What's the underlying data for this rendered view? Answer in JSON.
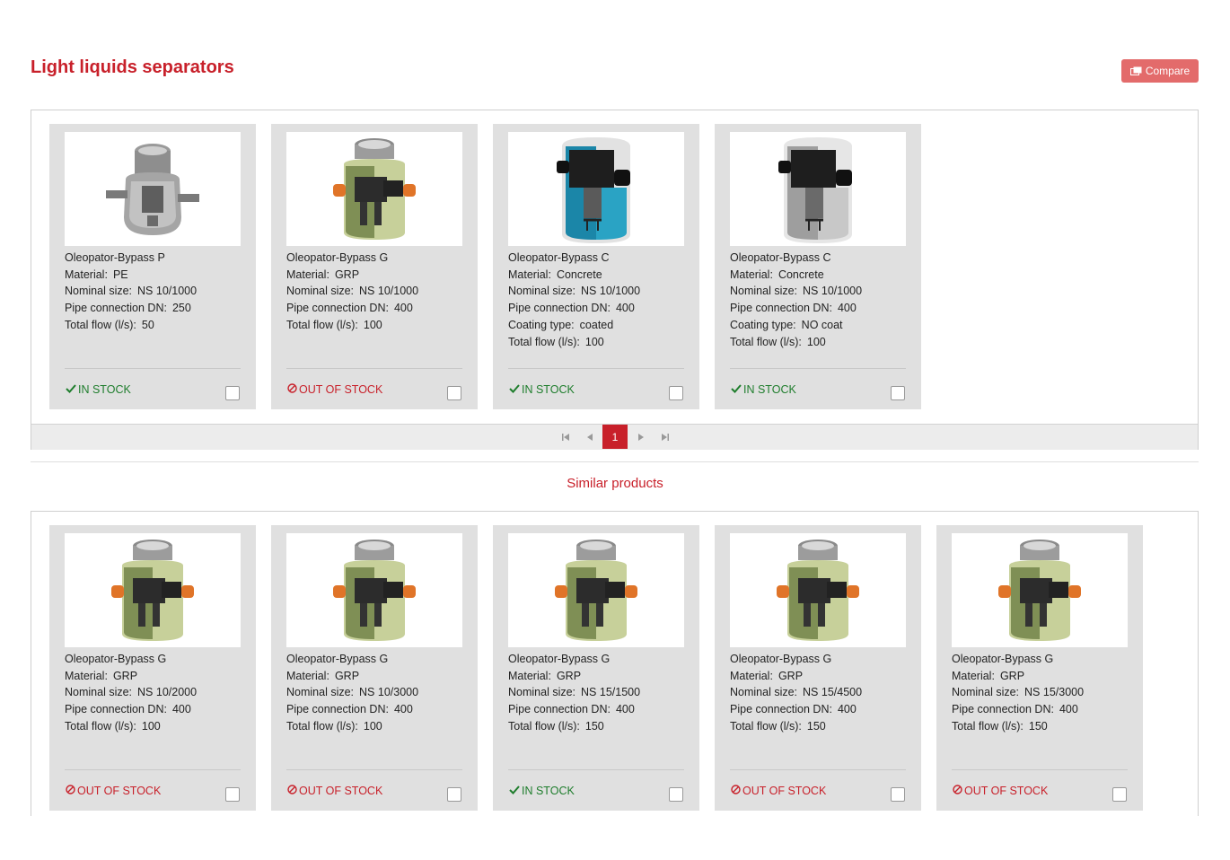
{
  "header": {
    "title": "Light liquids separators",
    "compare_label": "Compare"
  },
  "labels": {
    "material": "Material:",
    "nominal_size": "Nominal size:",
    "pipe_connection": "Pipe connection DN:",
    "coating_type": "Coating type:",
    "total_flow": "Total flow (l/s):",
    "in_stock": "IN STOCK",
    "out_of_stock": "OUT OF STOCK"
  },
  "products": [
    {
      "name": "Oleopator-Bypass P",
      "material": "PE",
      "nominal_size": "NS 10/1000",
      "pipe_connection": "250",
      "total_flow": "50",
      "in_stock": true,
      "image": "oleopator-p"
    },
    {
      "name": "Oleopator-Bypass G",
      "material": "GRP",
      "nominal_size": "NS 10/1000",
      "pipe_connection": "400",
      "total_flow": "100",
      "in_stock": false,
      "image": "oleopator-g"
    },
    {
      "name": "Oleopator-Bypass C",
      "material": "Concrete",
      "nominal_size": "NS 10/1000",
      "pipe_connection": "400",
      "coating_type": "coated",
      "total_flow": "100",
      "in_stock": true,
      "image": "oleopator-c-coated"
    },
    {
      "name": "Oleopator-Bypass C",
      "material": "Concrete",
      "nominal_size": "NS 10/1000",
      "pipe_connection": "400",
      "coating_type": "NO coat",
      "total_flow": "100",
      "in_stock": true,
      "image": "oleopator-c-plain"
    }
  ],
  "pagination": {
    "current_page": "1"
  },
  "similar": {
    "title": "Similar products",
    "products": [
      {
        "name": "Oleopator-Bypass G",
        "material": "GRP",
        "nominal_size": "NS 10/2000",
        "pipe_connection": "400",
        "total_flow": "100",
        "in_stock": false,
        "image": "oleopator-g"
      },
      {
        "name": "Oleopator-Bypass G",
        "material": "GRP",
        "nominal_size": "NS 10/3000",
        "pipe_connection": "400",
        "total_flow": "100",
        "in_stock": false,
        "image": "oleopator-g"
      },
      {
        "name": "Oleopator-Bypass G",
        "material": "GRP",
        "nominal_size": "NS 15/1500",
        "pipe_connection": "400",
        "total_flow": "150",
        "in_stock": true,
        "image": "oleopator-g"
      },
      {
        "name": "Oleopator-Bypass G",
        "material": "GRP",
        "nominal_size": "NS 15/4500",
        "pipe_connection": "400",
        "total_flow": "150",
        "in_stock": false,
        "image": "oleopator-g"
      },
      {
        "name": "Oleopator-Bypass G",
        "material": "GRP",
        "nominal_size": "NS 15/3000",
        "pipe_connection": "400",
        "total_flow": "150",
        "in_stock": false,
        "image": "oleopator-g"
      }
    ]
  },
  "colors": {
    "accent": "#c8202a",
    "compare_button": "#e36b6b",
    "in_stock": "#1e7d2c",
    "card_bg": "#e0e0e0"
  }
}
